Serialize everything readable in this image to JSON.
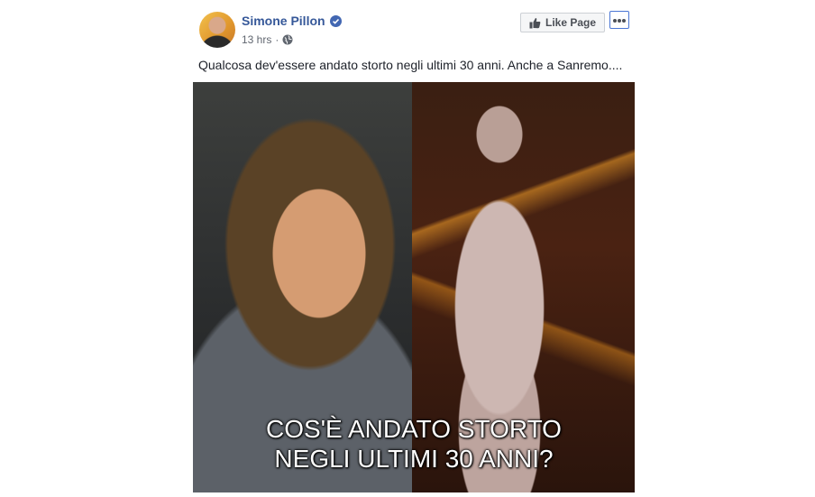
{
  "post": {
    "author": "Simone Pillon",
    "verified": true,
    "time": "13 hrs",
    "privacy_icon": "globe-icon",
    "text": "Qualcosa dev'essere andato storto negli ultimi 30 anni. Anche a Sanremo....",
    "like_page_label": "Like Page",
    "more_icon": "ellipsis-icon"
  },
  "image": {
    "caption_line1": "COS'È ANDATO STORTO",
    "caption_line2": "NEGLI ULTIMI 30 ANNI?"
  },
  "colors": {
    "link_blue": "#365899",
    "verified_blue": "#4267b2",
    "meta_gray": "#616770"
  }
}
